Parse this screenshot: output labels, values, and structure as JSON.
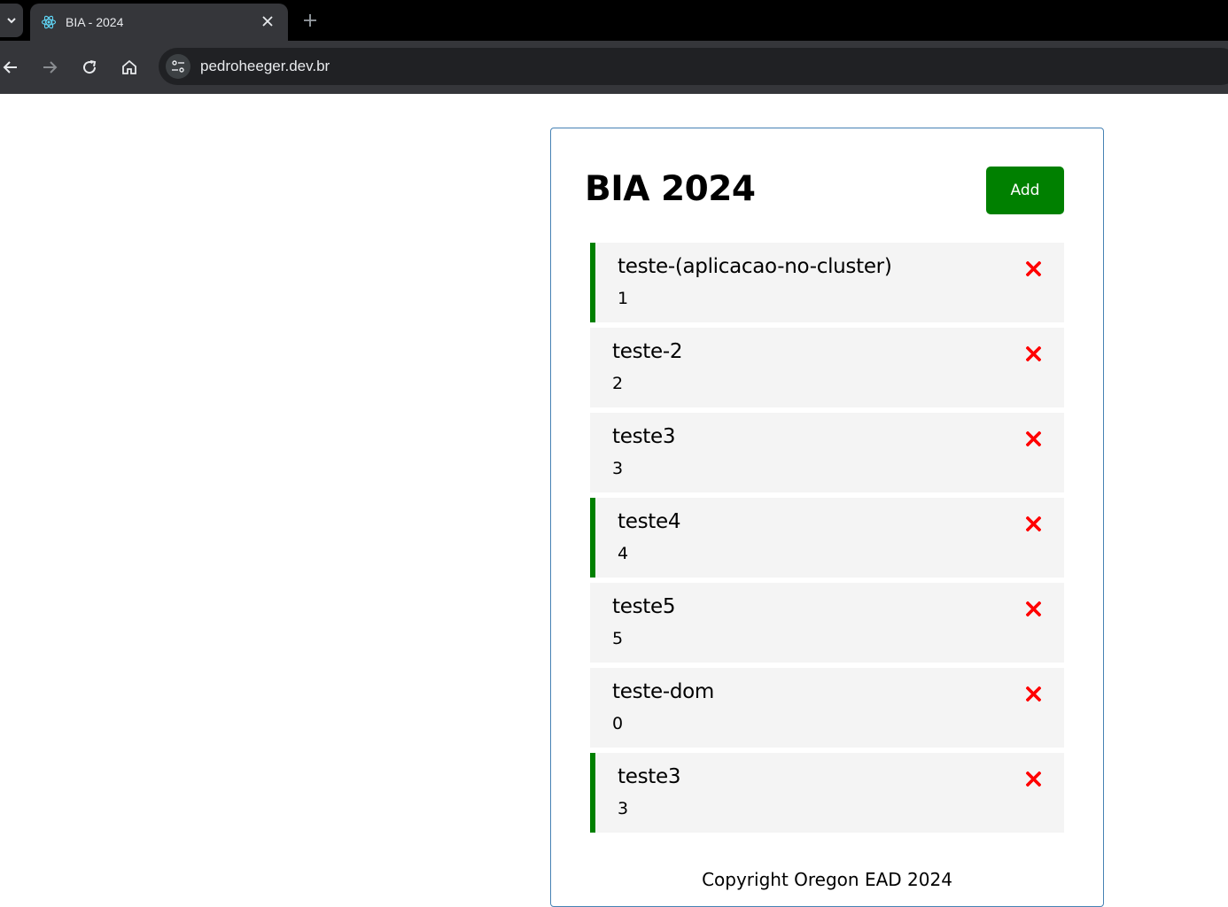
{
  "browser": {
    "tab_title": "BIA - 2024",
    "url": "pedroheeger.dev.br",
    "favicon_icon": "react-icon",
    "accent": "#35363a"
  },
  "app": {
    "title": "BIA 2024",
    "add_label": "Add",
    "add_color": "#008000",
    "delete_color": "#ff0000",
    "footer": "Copyright Oregon EAD 2024"
  },
  "tasks": [
    {
      "text": "teste-(aplicacao-no-cluster)",
      "day": "1",
      "reminder": true
    },
    {
      "text": "teste-2",
      "day": "2",
      "reminder": false
    },
    {
      "text": "teste3",
      "day": "3",
      "reminder": false
    },
    {
      "text": "teste4",
      "day": "4",
      "reminder": true
    },
    {
      "text": "teste5",
      "day": "5",
      "reminder": false
    },
    {
      "text": "teste-dom",
      "day": "0",
      "reminder": false
    },
    {
      "text": "teste3",
      "day": "3",
      "reminder": true
    }
  ]
}
